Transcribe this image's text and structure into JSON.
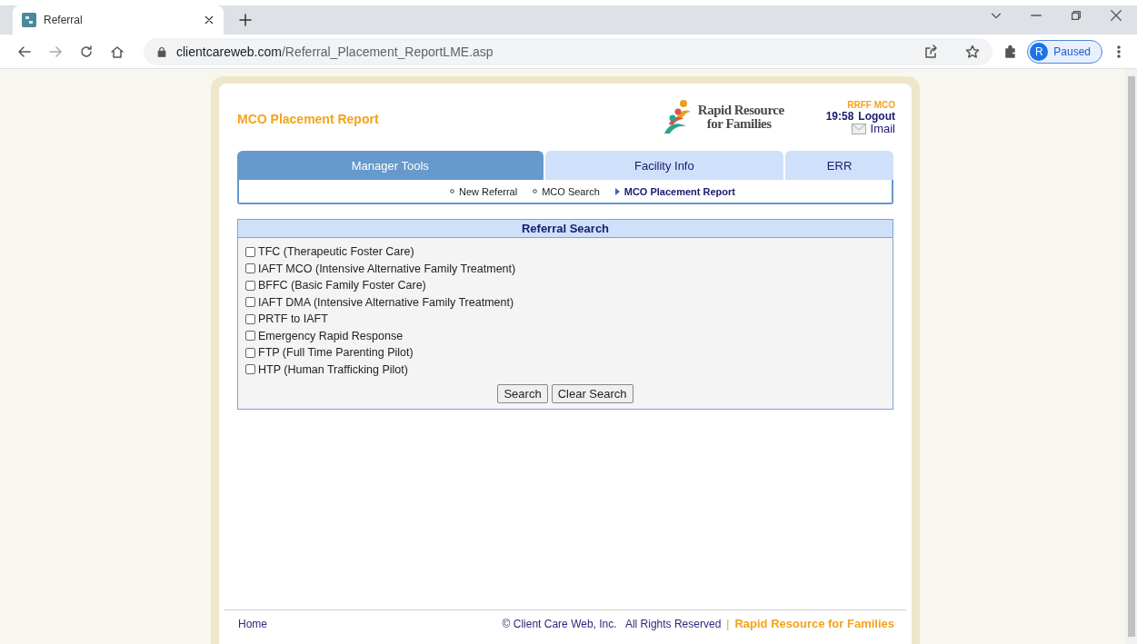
{
  "browser": {
    "tab_title": "Referral",
    "url_host": "clientcareweb.com",
    "url_path": "/Referral_Placement_ReportLME.asp",
    "profile_initial": "R",
    "profile_status": "Paused"
  },
  "header": {
    "title": "MCO Placement Report",
    "logo_line_1": "Rapid Resource",
    "logo_line_2": "for Families",
    "user": "RRFF MCO",
    "time": "19:58",
    "logout": "Logout",
    "imail": "Imail"
  },
  "tabs": [
    {
      "label": "Manager Tools",
      "selected": true
    },
    {
      "label": "Facility Info",
      "selected": false
    },
    {
      "label": "ERR",
      "selected": false
    }
  ],
  "subnav": [
    {
      "label": "New Referral",
      "selected": false
    },
    {
      "label": "MCO Search",
      "selected": false
    },
    {
      "label": "MCO Placement Report",
      "selected": true
    }
  ],
  "panel": {
    "title": "Referral Search",
    "options": [
      {
        "label": "TFC (Therapeutic Foster Care)",
        "checked": false
      },
      {
        "label": "IAFT MCO (Intensive Alternative Family Treatment)",
        "checked": false
      },
      {
        "label": "BFFC (Basic Family Foster Care)",
        "checked": false
      },
      {
        "label": "IAFT DMA (Intensive Alternative Family Treatment)",
        "checked": false
      },
      {
        "label": "PRTF to IAFT",
        "checked": false
      },
      {
        "label": "Emergency Rapid Response",
        "checked": false
      },
      {
        "label": "FTP (Full Time Parenting Pilot)",
        "checked": false
      },
      {
        "label": "HTP (Human Trafficking Pilot)",
        "checked": false
      }
    ],
    "buttons": [
      "Search",
      "Clear Search"
    ]
  },
  "footer": {
    "home": "Home",
    "copyright": "© Client Care Web, Inc.   All Rights Reserved",
    "separator": "|",
    "brand": "Rapid Resource for Families"
  }
}
